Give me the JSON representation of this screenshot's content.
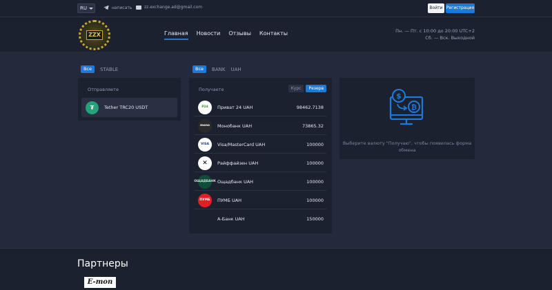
{
  "topbar": {
    "language": "RU",
    "telegram_label": "написать",
    "email": "zz.exchange.ad@gmail.com",
    "login_label": "Войти",
    "register_label": "Регистрация"
  },
  "header": {
    "logo_text": "ZZX",
    "nav": [
      {
        "label": "Главная",
        "active": true
      },
      {
        "label": "Новости",
        "active": false
      },
      {
        "label": "Отзывы",
        "active": false
      },
      {
        "label": "Контакты",
        "active": false
      }
    ],
    "hours_line1": "Пн. — Пт. с 10:00 до 20:00 UTC+2",
    "hours_line2": "Сб. — Вск. Выходной"
  },
  "send": {
    "filters": [
      "Все",
      "STABLE"
    ],
    "title": "Отправляете",
    "items": [
      {
        "name": "Tether TRC20 USDT",
        "icon": "tether-icon",
        "glyph": "₮"
      }
    ]
  },
  "receive": {
    "filters": [
      "Все",
      "BANK",
      "UAH"
    ],
    "title": "Получаете",
    "tabs": [
      "Курс",
      "Резерв"
    ],
    "items": [
      {
        "name": "Приват 24 UAH",
        "amount": "98462.7138",
        "icon": "privat24-icon",
        "glyph": "P24"
      },
      {
        "name": "Монобанк UAH",
        "amount": "73865.32",
        "icon": "monobank-icon",
        "glyph": "mono"
      },
      {
        "name": "Visa/MasterCard UAH",
        "amount": "100000",
        "icon": "visa-mastercard-icon",
        "glyph": "VISA"
      },
      {
        "name": "Райффайзен UAH",
        "amount": "100000",
        "icon": "raiffeisen-icon",
        "glyph": "✕"
      },
      {
        "name": "Ощадбанк UAH",
        "amount": "100000",
        "icon": "oschadbank-icon",
        "glyph": "ОЩАДБАНК"
      },
      {
        "name": "ПУМБ UAH",
        "amount": "100000",
        "icon": "pumb-icon",
        "glyph": "ПУМБ"
      },
      {
        "name": "А-Банк UAH",
        "amount": "150000",
        "icon": "abank-icon",
        "glyph": ""
      }
    ]
  },
  "info": {
    "text": "Выберите валюту \"Получаю\", чтобы появилась форма обмена"
  },
  "partners": {
    "title": "Партнеры",
    "logos": [
      "E-mon"
    ]
  },
  "colors": {
    "accent": "#1e7ad8",
    "panel": "#1c2130",
    "background": "#242a3b"
  }
}
